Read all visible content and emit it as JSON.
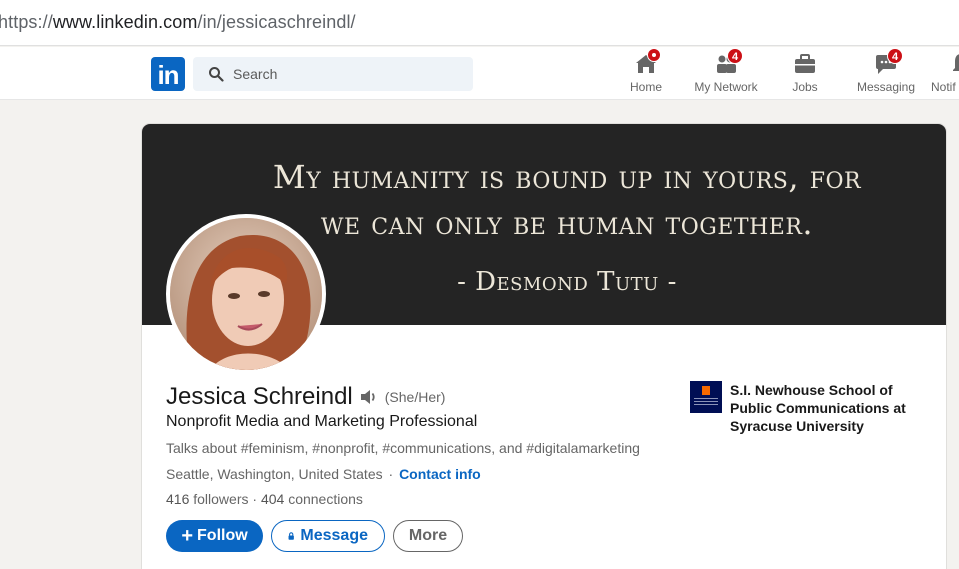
{
  "browser": {
    "url_prefix": "https://",
    "url_host": "www.linkedin.com",
    "url_path": "/in/jessicaschreindl/"
  },
  "nav": {
    "logo_text": "in",
    "search_placeholder": "Search",
    "items": [
      {
        "label": "Home",
        "icon": "home-icon",
        "badge": ""
      },
      {
        "label": "My Network",
        "icon": "network-icon",
        "badge": "4"
      },
      {
        "label": "Jobs",
        "icon": "briefcase-icon",
        "badge": ""
      },
      {
        "label": "Messaging",
        "icon": "messaging-icon",
        "badge": "4"
      },
      {
        "label": "Notif",
        "icon": "bell-icon",
        "badge": ""
      }
    ]
  },
  "banner": {
    "quote_line1": "My humanity is bound up in yours, for",
    "quote_line2": "we can only be human together.",
    "author": "- Desmond Tutu -"
  },
  "profile": {
    "name": "Jessica Schreindl",
    "pronouns": "(She/Her)",
    "headline": "Nonprofit Media and Marketing Professional",
    "talks_about": "Talks about #feminism, #nonprofit, #communications, and #digitalamarketing",
    "location": "Seattle, Washington, United States",
    "location_sep": "·",
    "contact_info": "Contact info",
    "followers_count": "416",
    "followers_label": "followers",
    "connections_sep": "·",
    "connections_count": "404",
    "connections_label": "connections"
  },
  "actions": {
    "follow_label": "Follow",
    "follow_plus": "+",
    "message_label": "Message",
    "more_label": "More"
  },
  "education": {
    "school_name": "S.I. Newhouse School of Public Communications at Syracuse University"
  },
  "colors": {
    "brand": "#0a66c2",
    "badge": "#cc1016",
    "banner_bg": "#242424"
  }
}
